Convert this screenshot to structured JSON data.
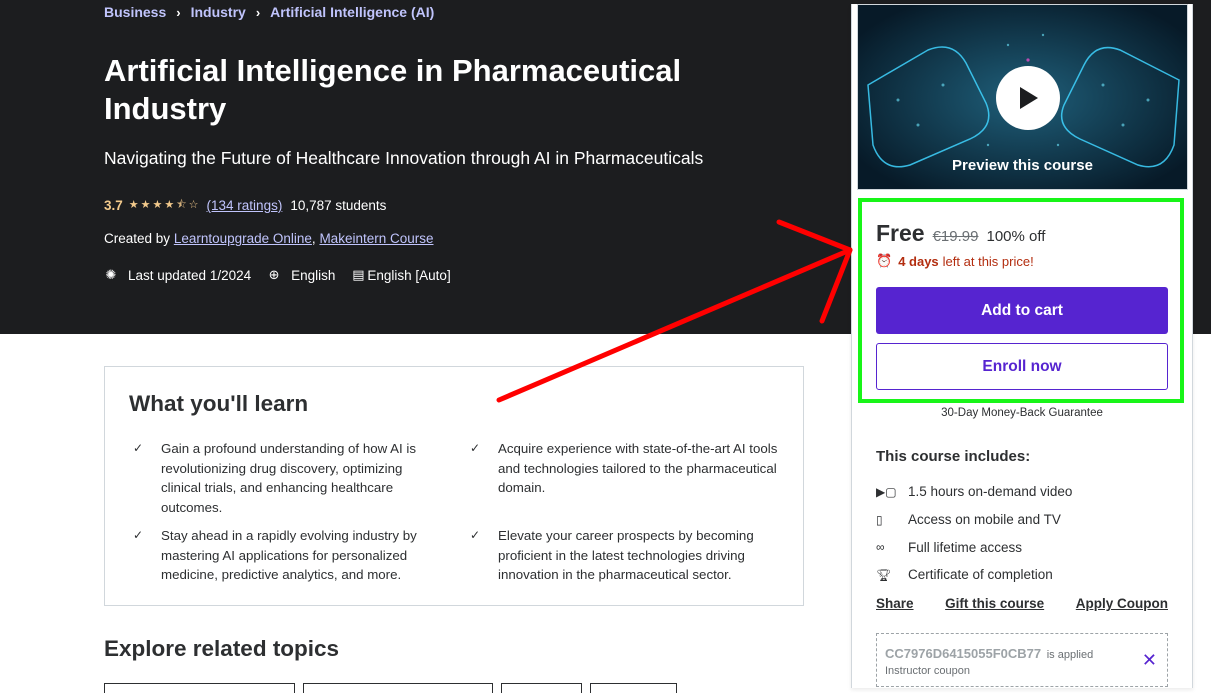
{
  "breadcrumb": [
    "Business",
    "Industry",
    "Artificial Intelligence (AI)"
  ],
  "course": {
    "title": "Artificial Intelligence in Pharmaceutical Industry",
    "subtitle": "Navigating the Future of Healthcare Innovation through AI in Pharmaceuticals",
    "rating": "3.7",
    "rating_value": 3.7,
    "ratings_count": "(134 ratings)",
    "students": "10,787 students",
    "created_by_label": "Created by",
    "instructors": [
      "Learntoupgrade Online",
      "Makeintern Course"
    ],
    "last_updated": "Last updated 1/2024",
    "language": "English",
    "captions": "English [Auto]"
  },
  "learn": {
    "title": "What you'll learn",
    "items": [
      "Gain a profound understanding of how AI is revolutionizing drug discovery, optimizing clinical trials, and enhancing healthcare outcomes.",
      "Acquire experience with state-of-the-art AI tools and technologies tailored to the pharmaceutical domain.",
      "Stay ahead in a rapidly evolving industry by mastering AI applications for personalized medicine, predictive analytics, and more.",
      "Elevate your career prospects by becoming proficient in the latest technologies driving innovation in the pharmaceutical sector."
    ]
  },
  "explore_title": "Explore related topics",
  "sidebar": {
    "preview_label": "Preview this course",
    "price": "Free",
    "original_price": "€19.99",
    "discount": "100% off",
    "timer_bold": "4 days",
    "timer_text": "left at this price!",
    "add_to_cart": "Add to cart",
    "enroll_now": "Enroll now",
    "guarantee": "30-Day Money-Back Guarantee",
    "includes_title": "This course includes:",
    "includes": [
      {
        "icon": "video-icon",
        "label": "1.5 hours on-demand video"
      },
      {
        "icon": "mobile-icon",
        "label": "Access on mobile and TV"
      },
      {
        "icon": "infinity-icon",
        "label": "Full lifetime access"
      },
      {
        "icon": "trophy-icon",
        "label": "Certificate of completion"
      }
    ],
    "share": "Share",
    "gift": "Gift this course",
    "apply_coupon": "Apply Coupon",
    "coupon_code": "CC7976D6415055F0CB77",
    "coupon_applied": "is applied",
    "coupon_type": "Instructor coupon"
  },
  "colors": {
    "hero_bg": "#1c1d1f",
    "accent_purple": "#5624d0",
    "link_lavender": "#c0c4fc",
    "star_gold": "#f3ca8c",
    "timer_red": "#b32d0f",
    "highlight_green": "#18f518",
    "annotation_arrow": "#ff0000"
  }
}
